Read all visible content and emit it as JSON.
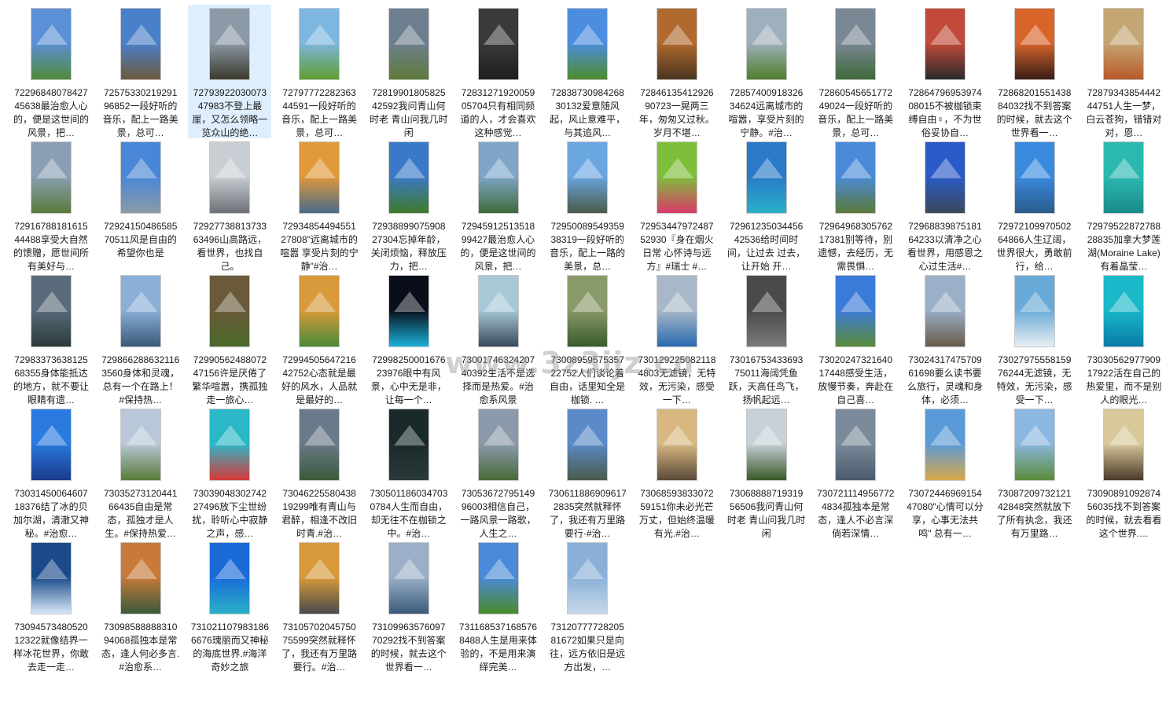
{
  "files": [
    {
      "name": "7229684807842745638最治愈人心的，便是这世间的风景，把…",
      "top": "#5b8fd6",
      "bottom": "#4f8a3a"
    },
    {
      "name": "7257533021929196852一段好听的音乐，配上一路美景，总可…",
      "top": "#4a7fc9",
      "bottom": "#6b5a3e"
    },
    {
      "name": "7279392203007347983不登上最崖，又怎么领略一览众山的绝…",
      "top": "#8c99a6",
      "bottom": "#3b3a2e"
    },
    {
      "name": "7279777228236344591一段好听的音乐，配上一路美景，总可…",
      "top": "#7db6e0",
      "bottom": "#5f9e2f"
    },
    {
      "name": "7281990180582542592我问青山何时老 青山问我几时闲",
      "top": "#6d7f8f",
      "bottom": "#5e7a3a"
    },
    {
      "name": "7283127192005905704只有相同频道的人，才会喜欢这种感觉…",
      "top": "#3a3a3a",
      "bottom": "#1e1e1e"
    },
    {
      "name": "7283873098426830132爱意随风起，风止意难平，与其追风…",
      "top": "#4c8de0",
      "bottom": "#4d8b2e"
    },
    {
      "name": "7284613541292690723一晃两三年，匆匆又过秋。岁月不堪…",
      "top": "#b06a2e",
      "bottom": "#4a3520"
    },
    {
      "name": "7285740091832634624远离城市的喧嚣，享受片刻的宁静。#治…",
      "top": "#9fb0bd",
      "bottom": "#4f7f2c"
    },
    {
      "name": "7286054565177249024一段好听的音乐，配上一路美景，总可…",
      "top": "#7a8794",
      "bottom": "#3f6a3a"
    },
    {
      "name": "7286479695397408015不被枷锁束缚自由♀，不为世俗妥协自…",
      "top": "#c24a3a",
      "bottom": "#2b2b2b"
    },
    {
      "name": "7286820155143884032找不到答案的时候，就去这个世界看一…",
      "top": "#d9642a",
      "bottom": "#3a1e18"
    },
    {
      "name": "7287934385444244751人生一梦，白云苍狗，错错对对，恩…",
      "top": "#c4a574",
      "bottom": "#b85a2a"
    },
    {
      "name": "7291678818161544488享受大自然的馈赠，愿世间所有美好与…",
      "top": "#8a9fb3",
      "bottom": "#5a7a3a"
    },
    {
      "name": "7292415048658570511风是自由的 希望你也是",
      "top": "#4a86d8",
      "bottom": "#8a9aa8"
    },
    {
      "name": "7292773881373363496山高路远，看世界，也找自己。",
      "top": "#c9ced4",
      "bottom": "#6e7278"
    },
    {
      "name": "7293485449455127808\"远离城市的喧嚣 享受片刻的宁静\"#治…",
      "top": "#e09a3a",
      "bottom": "#4a6a8a"
    },
    {
      "name": "7293889907590827304忘掉年龄，关闭烦恼，释放压力，把…",
      "top": "#3a78c8",
      "bottom": "#3f7a2a"
    },
    {
      "name": "7294591251351899427最治愈人心的，便是这世间的风景，把…",
      "top": "#7fa6c9",
      "bottom": "#3e6b3a"
    },
    {
      "name": "7295008954935938319一段好听的音乐，配上一路的美景，总…",
      "top": "#6aa6e0",
      "bottom": "#4a5a4a"
    },
    {
      "name": "7295344797248752930『身在烟火日常 心怀诗与远方』#瑞士 #…",
      "top": "#7dbf3a",
      "bottom": "#d83a6a"
    },
    {
      "name": "7296123503445642536给时间时间，让过去 过去，让开始 开…",
      "top": "#2a7ac8",
      "bottom": "#2ab0c9"
    },
    {
      "name": "7296496830576217381别等待，别遗憾，去经历，无需畏惧…",
      "top": "#4a8ad8",
      "bottom": "#5a7a3a"
    },
    {
      "name": "7296883987518164233以清净之心看世界，用感恩之心过生活#…",
      "top": "#2a5ac8",
      "bottom": "#3a4a5a"
    },
    {
      "name": "7297210997050264866人生辽阔，世界很大，勇敢前行，给…",
      "top": "#3a8ae0",
      "bottom": "#2a5a8a"
    },
    {
      "name": "7297952287278828835加拿大梦莲湖(Moraine Lake) 有着晶莹…",
      "top": "#2ab8b0",
      "bottom": "#1a8a8a"
    },
    {
      "name": "7298337363812568355身体能抵达的地方，就不要让眼睛有遗…",
      "top": "#5a6a7a",
      "bottom": "#2a3a3a"
    },
    {
      "name": "7298662886321163560身体和灵魂，总有一个在路上！#保持热…",
      "top": "#8ab0d8",
      "bottom": "#3a5a7a"
    },
    {
      "name": "7299056248807247156许是厌倦了繁华喧嚣，携孤独走一旅心…",
      "top": "#6a5a3a",
      "bottom": "#4a6a2a"
    },
    {
      "name": "7299450564721642752心态就是最好的风水，人品就是最好的…",
      "top": "#d89a3a",
      "bottom": "#4a8a3a"
    },
    {
      "name": "7299825000167623976眼中有风景，心中无是非，让每一个…",
      "top": "#0a0e1a",
      "bottom": "#1ab0d8"
    },
    {
      "name": "7300174632420740392生活不是选择而是热爱。#治愈系风景",
      "top": "#a8c8d8",
      "bottom": "#3a4a5a"
    },
    {
      "name": "7300895957535722752人们谈论着自由，话里知全是枷锁.  …",
      "top": "#8a9a6a",
      "bottom": "#3a5a2a"
    },
    {
      "name": "7301292250821184803无滤镜，无特效，无污染，感受一下…",
      "top": "#a8b8c8",
      "bottom": "#2a6ab0"
    },
    {
      "name": "7301675343369375011海阔凭鱼跃，天高任鸟飞，扬帆起远…",
      "top": "#4a4a4a",
      "bottom": "#7a7a7a"
    },
    {
      "name": "7302024732164017448感受生活，放慢节奏，奔赴在自己喜…",
      "top": "#3a7ad8",
      "bottom": "#5a8a3a"
    },
    {
      "name": "7302431747570961698要么读书要么旅行，灵魂和身体，必须…",
      "top": "#9ab0c8",
      "bottom": "#6a5a4a"
    },
    {
      "name": "7302797555815976244无滤镜，无特效，无污染，感受一下…",
      "top": "#6aaad8",
      "bottom": "#e8eef2"
    },
    {
      "name": "7303056297790917922活在自己的热爱里，而不是别人的眼光…",
      "top": "#1ab8c8",
      "bottom": "#0a7aa8"
    },
    {
      "name": "7303145006460718376结了冰的贝加尔湖，清澈又神秘。#治愈…",
      "top": "#2a7ae0",
      "bottom": "#1a3a8a"
    },
    {
      "name": "7303527312044166435自由是常态，孤独才是人生。#保持热爱…",
      "top": "#b8c8d8",
      "bottom": "#5a7a3a"
    },
    {
      "name": "7303904830274227496放下尘世纷扰，聆听心中寂静之声，感…",
      "top": "#2ab8c8",
      "bottom": "#d83a3a"
    },
    {
      "name": "7304622558043819299唯有青山与君醉，相逢不改旧时青.#治…",
      "top": "#6a7a8a",
      "bottom": "#3a5a3a"
    },
    {
      "name": "7305011860347030784人生而自由，却无往不在枷锁之中。#治…",
      "top": "#1a2a2a",
      "bottom": "#2a3a3a"
    },
    {
      "name": "7305367279514996003相信自己，一路风景一路歌，人生之…",
      "top": "#8a9aaa",
      "bottom": "#4a6a3a"
    },
    {
      "name": "7306118869096172835突然就释怀了，我还有万里路要行·#治…",
      "top": "#5a8ac8",
      "bottom": "#4a5a4a"
    },
    {
      "name": "7306859383307259151你未必光芒万丈，但始终温暖有光.#治…",
      "top": "#d8b880",
      "bottom": "#5a4a3a"
    },
    {
      "name": "7306888871931956506我问青山何时老 青山问我几时闲",
      "top": "#c8d0d8",
      "bottom": "#3a5a2a"
    },
    {
      "name": "7307211149567724834孤独本是常态，逢人不必言深倘若深情…",
      "top": "#7a8a9a",
      "bottom": "#4a5a6a"
    },
    {
      "name": "7307244696915447080\"心情可以分享，心事无法共鸣\" 总有一…",
      "top": "#5a9ad8",
      "bottom": "#d8a84a"
    },
    {
      "name": "7308720973212142848突然就放下了所有执念，我还有万里路…",
      "top": "#8ab8e0",
      "bottom": "#5a8a3a"
    },
    {
      "name": "7309089109287456035找不到答案的时候，就去看看这个世界.…",
      "top": "#d8c89a",
      "bottom": "#4a3a2a"
    },
    {
      "name": "7309457348052012322就像结界一样冰花世界，你敢去走一走…",
      "top": "#1a4a8a",
      "bottom": "#d8e8f8"
    },
    {
      "name": "7309858888831094068孤独本是常态，逢人何必多言.#治愈系…",
      "top": "#c87a3a",
      "bottom": "#3a5a3a"
    },
    {
      "name": "7310211079831866676瑰丽而又神秘的海底世界.#海洋奇妙之旅",
      "top": "#1a6ad8",
      "bottom": "#2ab0c8"
    },
    {
      "name": "7310570204575075599突然就释怀了，我还有万里路要行。#治…",
      "top": "#d89a3a",
      "bottom": "#4a4a4a"
    },
    {
      "name": "7310996357609770292找不到答案的时候，就去这个世界看一…",
      "top": "#9ab0c8",
      "bottom": "#3a5a7a"
    },
    {
      "name": "7311685371685768488人生是用来体验的，不是用来演绎完美…",
      "top": "#4a8ad8",
      "bottom": "#4a8a2a"
    },
    {
      "name": "7312077772820581672如果只是向往，远方依旧是远方出发，…",
      "top": "#8ab0d8",
      "bottom": "#c8d8e8"
    }
  ],
  "selected_index": 2,
  "watermark": "www.3z3ijz.cn"
}
